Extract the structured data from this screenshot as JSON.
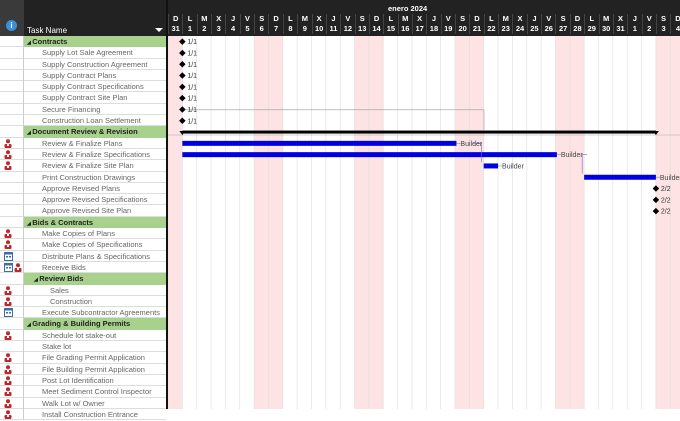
{
  "header": {
    "info_icon": "i",
    "task_name_label": "Task Name",
    "month": "enero 2024"
  },
  "days": [
    [
      "D",
      "31"
    ],
    [
      "L",
      "1"
    ],
    [
      "M",
      "2"
    ],
    [
      "X",
      "3"
    ],
    [
      "J",
      "4"
    ],
    [
      "V",
      "5"
    ],
    [
      "S",
      "6"
    ],
    [
      "D",
      "7"
    ],
    [
      "L",
      "8"
    ],
    [
      "M",
      "9"
    ],
    [
      "X",
      "10"
    ],
    [
      "J",
      "11"
    ],
    [
      "V",
      "12"
    ],
    [
      "S",
      "13"
    ],
    [
      "D",
      "14"
    ],
    [
      "L",
      "15"
    ],
    [
      "M",
      "16"
    ],
    [
      "X",
      "17"
    ],
    [
      "J",
      "18"
    ],
    [
      "V",
      "19"
    ],
    [
      "S",
      "20"
    ],
    [
      "D",
      "21"
    ],
    [
      "L",
      "22"
    ],
    [
      "M",
      "23"
    ],
    [
      "X",
      "24"
    ],
    [
      "J",
      "25"
    ],
    [
      "V",
      "26"
    ],
    [
      "S",
      "27"
    ],
    [
      "D",
      "28"
    ],
    [
      "L",
      "29"
    ],
    [
      "M",
      "30"
    ],
    [
      "X",
      "31"
    ],
    [
      "J",
      "1"
    ],
    [
      "V",
      "2"
    ],
    [
      "S",
      "3"
    ],
    [
      "D",
      "4"
    ]
  ],
  "weekend_columns": [
    0,
    6,
    7,
    13,
    14,
    20,
    21,
    27,
    28,
    34,
    35
  ],
  "colors": {
    "summary": "#a9d18e",
    "bar": "#0000e0",
    "weekend": "#fde3e3",
    "resource": "#c0282d",
    "calendar": "#3b6ea5"
  },
  "tasks": [
    {
      "name": "Contracts",
      "level": 1,
      "summary": true,
      "milestone": "1/1",
      "mday": 1
    },
    {
      "name": "Supply Lot Sale Agreement",
      "level": 2,
      "milestone": "1/1",
      "mday": 1
    },
    {
      "name": "Supply Construction Agreement",
      "level": 2,
      "milestone": "1/1",
      "mday": 1
    },
    {
      "name": "Supply Contract Plans",
      "level": 2,
      "milestone": "1/1",
      "mday": 1
    },
    {
      "name": "Supply Contract Specifications",
      "level": 2,
      "milestone": "1/1",
      "mday": 1
    },
    {
      "name": "Supply Contract Site Plan",
      "level": 2,
      "milestone": "1/1",
      "mday": 1
    },
    {
      "name": "Secure Financing",
      "level": 2,
      "milestone": "1/1",
      "mday": 1
    },
    {
      "name": "Construction Loan Settlement",
      "level": 2,
      "milestone": "1/1",
      "mday": 1
    },
    {
      "name": "Document Review & Revision",
      "level": 1,
      "summary": true,
      "sumbar": [
        1,
        34
      ]
    },
    {
      "name": "Review & Finalize Plans",
      "level": 2,
      "icons": [
        "resource"
      ],
      "bar": [
        1,
        19.1
      ],
      "resource": "Builder"
    },
    {
      "name": "Review & Finalize Specifications",
      "level": 2,
      "icons": [
        "resource"
      ],
      "bar": [
        1,
        26.1
      ],
      "resource": "Builder"
    },
    {
      "name": "Review & Finalize Site Plan",
      "level": 2,
      "icons": [
        "resource"
      ],
      "bar": [
        22,
        1
      ],
      "resource": "Builder"
    },
    {
      "name": "Print Construction Drawings",
      "level": 2,
      "bar": [
        29,
        5
      ],
      "resource": "Builder"
    },
    {
      "name": "Approve Revised Plans",
      "level": 2,
      "milestone": "2/2",
      "mday": 34
    },
    {
      "name": "Approve Revised Specifications",
      "level": 2,
      "milestone": "2/2",
      "mday": 34
    },
    {
      "name": "Approve Revised Site Plan",
      "level": 2,
      "milestone": "2/2",
      "mday": 34
    },
    {
      "name": "Bids & Contracts",
      "level": 1,
      "summary": true
    },
    {
      "name": "Make Copies of Plans",
      "level": 2,
      "icons": [
        "resource"
      ]
    },
    {
      "name": "Make Copies of Specifications",
      "level": 2,
      "icons": [
        "resource"
      ]
    },
    {
      "name": "Distribute Plans & Specifications",
      "level": 2,
      "icons": [
        "calendar"
      ]
    },
    {
      "name": "Receive Bids",
      "level": 2,
      "icons": [
        "calendar",
        "resource"
      ]
    },
    {
      "name": "Review Bids",
      "level": 2,
      "summary": true
    },
    {
      "name": "Sales",
      "level": 3,
      "icons": [
        "resource"
      ]
    },
    {
      "name": "Construction",
      "level": 3,
      "icons": [
        "resource"
      ]
    },
    {
      "name": "Execute Subcontractor Agreements",
      "level": 2,
      "icons": [
        "calendar"
      ]
    },
    {
      "name": "Grading & Building Permits",
      "level": 1,
      "summary": true
    },
    {
      "name": "Schedule lot stake-out",
      "level": 2,
      "icons": [
        "resource"
      ]
    },
    {
      "name": "Stake lot",
      "level": 2
    },
    {
      "name": "File Grading Permit Application",
      "level": 2,
      "icons": [
        "resource"
      ]
    },
    {
      "name": "File Building Permit Application",
      "level": 2,
      "icons": [
        "resource"
      ]
    },
    {
      "name": "Post Lot Identification",
      "level": 2,
      "icons": [
        "resource"
      ]
    },
    {
      "name": "Meet Sediment Control Inspector",
      "level": 2,
      "icons": [
        "resource"
      ]
    },
    {
      "name": "Walk Lot w/ Owner",
      "level": 2,
      "icons": [
        "resource"
      ]
    },
    {
      "name": "Install Construction Entrance",
      "level": 2,
      "icons": [
        "resource"
      ]
    }
  ]
}
